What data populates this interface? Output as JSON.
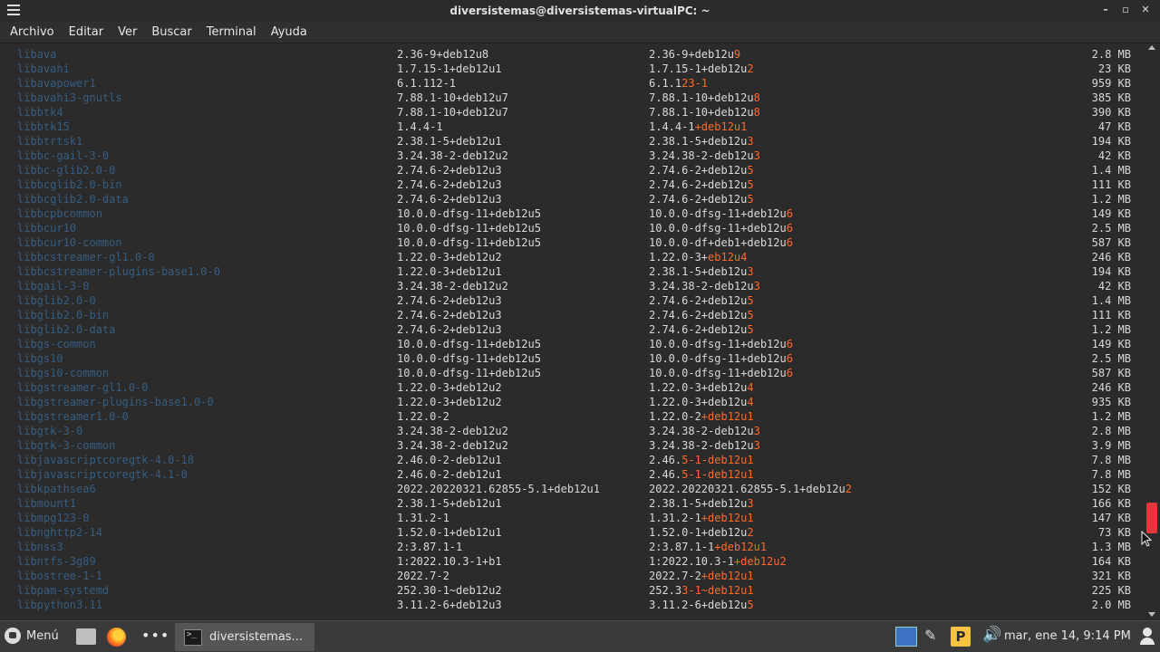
{
  "window": {
    "title": "diversistemas@diversistemas-virtualPC: ~"
  },
  "menu": [
    "Archivo",
    "Editar",
    "Ver",
    "Buscar",
    "Terminal",
    "Ayuda"
  ],
  "rows": [
    {
      "name": "libava",
      "old": "2.36-9+deb12u8",
      "new_base": "2.36-9+deb12u",
      "new_hl": "9",
      "size": "2.8 MB"
    },
    {
      "name": "libavahi",
      "old": "1.7.15-1+deb12u1",
      "new_base": "1.7.15-1+deb12u",
      "new_hl": "2",
      "size": "23 KB"
    },
    {
      "name": "libavapower1",
      "old": "6.1.112-1",
      "new_base": "6.1.1",
      "new_hl": "23-1",
      "size": "959 KB"
    },
    {
      "name": "libavahi3-gnutls",
      "old": "7.88.1-10+deb12u7",
      "new_base": "7.88.1-10+deb12u",
      "new_hl": "8",
      "size": "385 KB"
    },
    {
      "name": "libbtk4",
      "old": "7.88.1-10+deb12u7",
      "new_base": "7.88.1-10+deb12u",
      "new_hl": "8",
      "size": "390 KB"
    },
    {
      "name": "libbtk15",
      "old": "1.4.4-1",
      "new_base": "1.4.4-1",
      "new_hl": "+deb12u1",
      "size": "47 KB"
    },
    {
      "name": "libbtrtsk1",
      "old": "2.38.1-5+deb12u1",
      "new_base": "2.38.1-5+deb12u",
      "new_hl": "3",
      "size": "194 KB"
    },
    {
      "name": "libbc-gail-3-0",
      "old": "3.24.38-2-deb12u2",
      "new_base": "3.24.38-2-deb12u",
      "new_hl": "3",
      "size": "42 KB"
    },
    {
      "name": "libbc-glib2.0-0",
      "old": "2.74.6-2+deb12u3",
      "new_base": "2.74.6-2+deb12u",
      "new_hl": "5",
      "size": "1.4 MB"
    },
    {
      "name": "libbcglib2.0-bin",
      "old": "2.74.6-2+deb12u3",
      "new_base": "2.74.6-2+deb12u",
      "new_hl": "5",
      "size": "111 KB"
    },
    {
      "name": "libbcglib2.0-data",
      "old": "2.74.6-2+deb12u3",
      "new_base": "2.74.6-2+deb12u",
      "new_hl": "5",
      "size": "1.2 MB"
    },
    {
      "name": "libbcpbcommon",
      "old": "10.0.0-dfsg-11+deb12u5",
      "new_base": "10.0.0-dfsg-11+deb12u",
      "new_hl": "6",
      "size": "149 KB"
    },
    {
      "name": "libbcur10",
      "old": "10.0.0-dfsg-11+deb12u5",
      "new_base": "10.0.0-dfsg-11+deb12u",
      "new_hl": "6",
      "size": "2.5 MB"
    },
    {
      "name": "libbcur10-common",
      "old": "10.0.0-dfsg-11+deb12u5",
      "new_base": "10.0.0-df+deb1+deb12u",
      "new_hl": "6",
      "size": "587 KB"
    },
    {
      "name": "libbcstreamer-gl1.0-0",
      "old": "1.22.0-3+deb12u2",
      "new_base": "1.22.0-3+",
      "new_hl": "eb12u4",
      "size": "246 KB"
    },
    {
      "name": "libbcstreamer-plugins-base1.0-0",
      "old": "1.22.0-3+deb12u1",
      "new_base": "2.38.1-5+deb12u",
      "new_hl": "3",
      "size": "194 KB"
    },
    {
      "name": "libgail-3-0",
      "old": "3.24.38-2-deb12u2",
      "new_base": "3.24.38-2-deb12u",
      "new_hl": "3",
      "size": "42 KB"
    },
    {
      "name": "libglib2.0-0",
      "old": "2.74.6-2+deb12u3",
      "new_base": "2.74.6-2+deb12u",
      "new_hl": "5",
      "size": "1.4 MB"
    },
    {
      "name": "libglib2.0-bin",
      "old": "2.74.6-2+deb12u3",
      "new_base": "2.74.6-2+deb12u",
      "new_hl": "5",
      "size": "111 KB"
    },
    {
      "name": "libglib2.0-data",
      "old": "2.74.6-2+deb12u3",
      "new_base": "2.74.6-2+deb12u",
      "new_hl": "5",
      "size": "1.2 MB"
    },
    {
      "name": "libgs-common",
      "old": "10.0.0-dfsg-11+deb12u5",
      "new_base": "10.0.0-dfsg-11+deb12u",
      "new_hl": "6",
      "size": "149 KB"
    },
    {
      "name": "libgs10",
      "old": "10.0.0-dfsg-11+deb12u5",
      "new_base": "10.0.0-dfsg-11+deb12u",
      "new_hl": "6",
      "size": "2.5 MB"
    },
    {
      "name": "libgs10-common",
      "old": "10.0.0-dfsg-11+deb12u5",
      "new_base": "10.0.0-dfsg-11+deb12u",
      "new_hl": "6",
      "size": "587 KB"
    },
    {
      "name": "libgstreamer-gl1.0-0",
      "old": "1.22.0-3+deb12u2",
      "new_base": "1.22.0-3+deb12u",
      "new_hl": "4",
      "size": "246 KB"
    },
    {
      "name": "libgstreamer-plugins-base1.0-0",
      "old": "1.22.0-3+deb12u2",
      "new_base": "1.22.0-3+deb12u",
      "new_hl": "4",
      "size": "935 KB"
    },
    {
      "name": "libgstreamer1.0-0",
      "old": "1.22.0-2",
      "new_base": "1.22.0-2",
      "new_hl": "+deb12u1",
      "size": "1.2 MB"
    },
    {
      "name": "libgtk-3-0",
      "old": "3.24.38-2-deb12u2",
      "new_base": "3.24.38-2-deb12u",
      "new_hl": "3",
      "size": "2.8 MB"
    },
    {
      "name": "libgtk-3-common",
      "old": "3.24.38-2-deb12u2",
      "new_base": "3.24.38-2-deb12u",
      "new_hl": "3",
      "size": "3.9 MB"
    },
    {
      "name": "libjavascriptcoregtk-4.0-18",
      "old": "2.46.0-2-deb12u1",
      "new_base": "2.46.",
      "new_hl": "5-1-deb12u1",
      "size": "7.8 MB"
    },
    {
      "name": "libjavascriptcoregtk-4.1-0",
      "old": "2.46.0-2-deb12u1",
      "new_base": "2.46.",
      "new_hl": "5-1-deb12u1",
      "size": "7.8 MB"
    },
    {
      "name": "libkpathsea6",
      "old": "2022.20220321.62855-5.1+deb12u1",
      "new_base": "2022.20220321.62855-5.1+deb12u",
      "new_hl": "2",
      "size": "152 KB"
    },
    {
      "name": "libmount1",
      "old": "2.38.1-5+deb12u1",
      "new_base": "2.38.1-5+deb12u",
      "new_hl": "3",
      "size": "166 KB"
    },
    {
      "name": "libmpg123-0",
      "old": "1.31.2-1",
      "new_base": "1.31.2-1",
      "new_hl": "+deb12u1",
      "size": "147 KB"
    },
    {
      "name": "libnghttp2-14",
      "old": "1.52.0-1+deb12u1",
      "new_base": "1.52.0-1+deb12u",
      "new_hl": "2",
      "size": "73 KB"
    },
    {
      "name": "libnss3",
      "old": "2:3.87.1-1",
      "new_base": "2:3.87.1-1",
      "new_hl": "+deb12u1",
      "size": "1.3 MB"
    },
    {
      "name": "libntfs-3g89",
      "old": "1:2022.10.3-1+b1",
      "new_base": "1:2022.10.3-1",
      "new_hl": "+deb12u2",
      "size": "164 KB"
    },
    {
      "name": "libostree-1-1",
      "old": "2022.7-2",
      "new_base": "2022.7-2",
      "new_hl": "+deb12u1",
      "size": "321 KB"
    },
    {
      "name": "libpam-systemd",
      "old": "252.30-1~deb12u2",
      "new_base": "252.3",
      "new_hl": "3-1~deb12u1",
      "size": "225 KB"
    },
    {
      "name": "libpython3.11",
      "old": "3.11.2-6+deb12u3",
      "new_base": "3.11.2-6+deb12u",
      "new_hl": "5",
      "size": "2.0 MB"
    }
  ],
  "taskbar": {
    "menu_label": "Menú",
    "dots": "•••",
    "task_label": "diversistemas...",
    "clock": "mar, ene 14,  9:14 PM",
    "pen_glyph": "✎",
    "p_glyph": "P",
    "vol_glyph": "🔊"
  },
  "colors": {
    "highlight": "#ff6a2a",
    "scroll_thumb": "#e8343d"
  }
}
